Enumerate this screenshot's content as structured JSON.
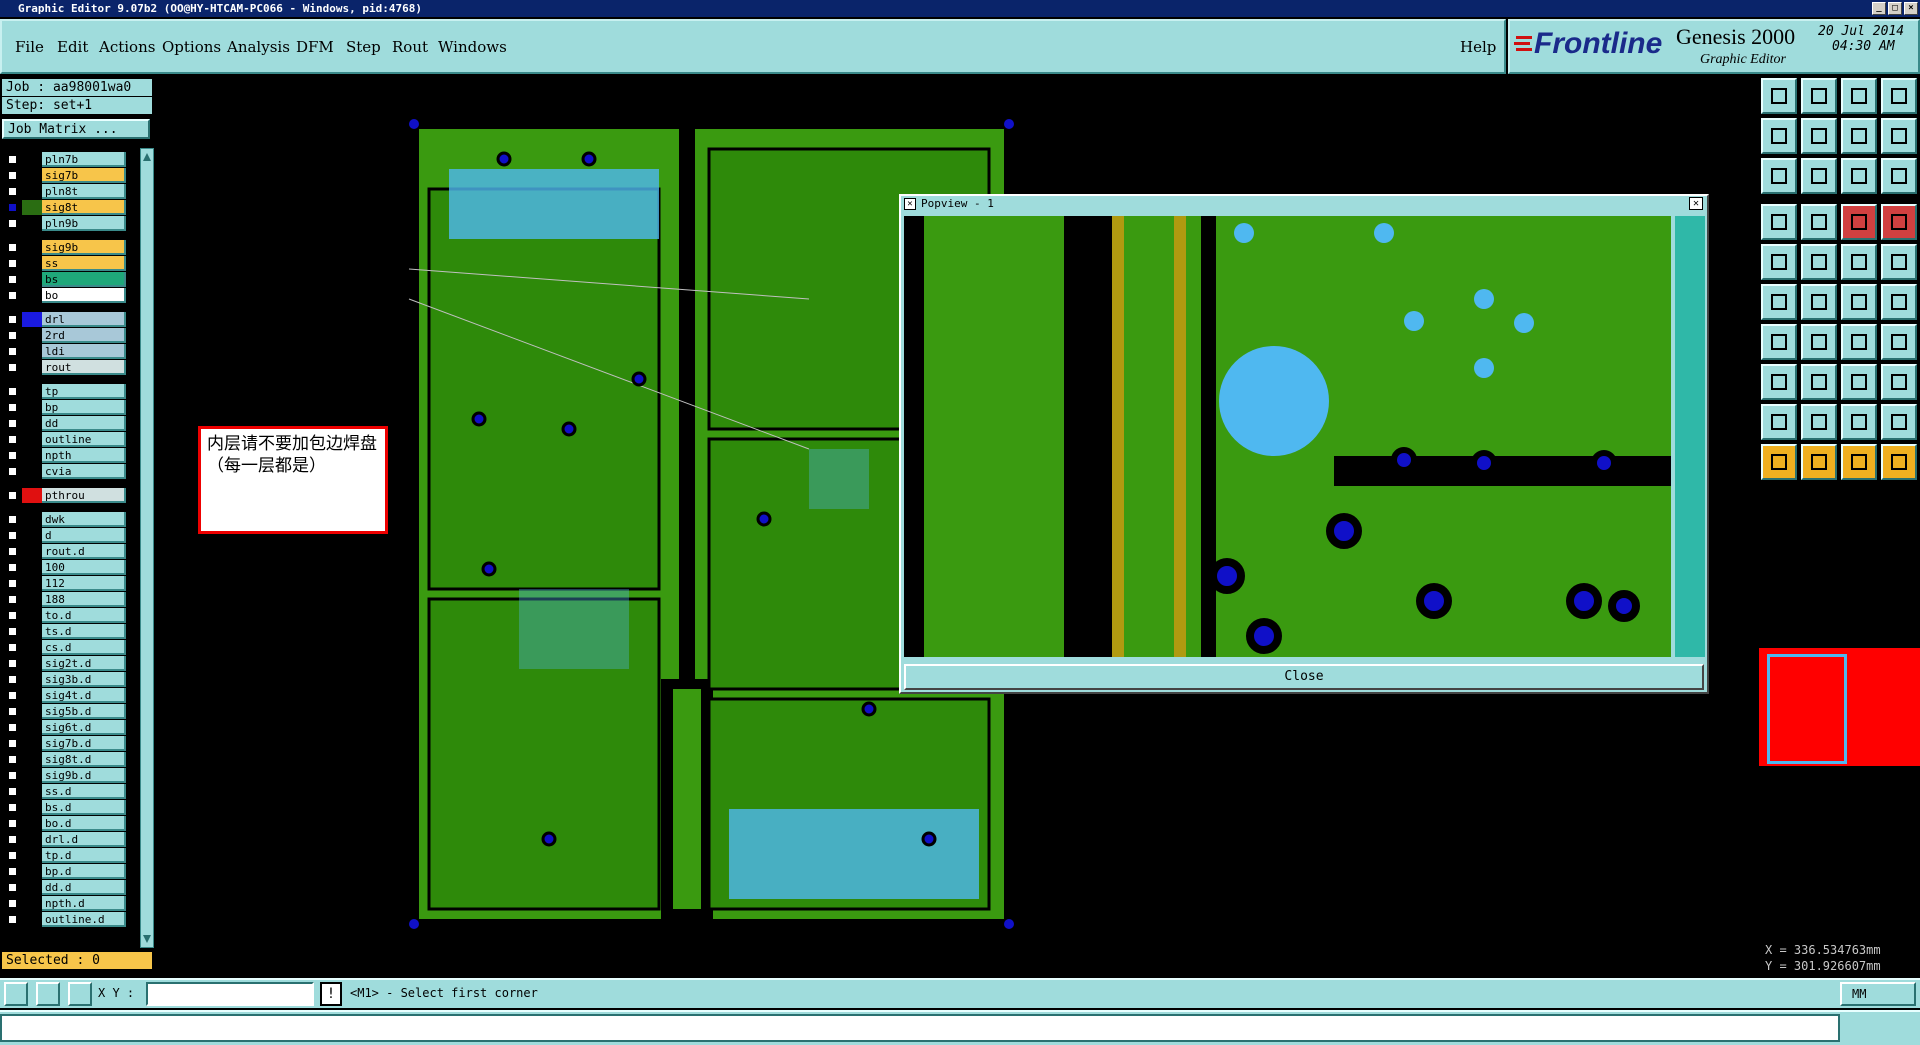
{
  "window": {
    "title": "Graphic Editor 9.07b2 (OO@HY-HTCAM-PC066 - Windows, pid:4768)",
    "controls": [
      "_",
      "□",
      "×"
    ]
  },
  "menu": [
    "File",
    "Edit",
    "Actions",
    "Options",
    "Analysis",
    "DFM",
    "Step",
    "Rout",
    "Windows"
  ],
  "help_label": "Help",
  "brand": {
    "logo": "Frontline",
    "product": "Genesis 2000",
    "subtitle": "Graphic Editor",
    "date": "20 Jul 2014",
    "time": "04:30 AM"
  },
  "job": {
    "label": "Job : aa98001wa0",
    "step": "Step: set+1",
    "matrix_button": "Job Matrix ..."
  },
  "layers": [
    {
      "name": "pln7b",
      "color": "#000000",
      "bg": "#9fdcdc"
    },
    {
      "name": "sig7b",
      "color": "#000000",
      "bg": "#f7c54a"
    },
    {
      "name": "pln8t",
      "color": "#000000",
      "bg": "#9fdcdc"
    },
    {
      "name": "sig8t",
      "color": "#2a6d12",
      "bg": "#f7c54a",
      "active": true
    },
    {
      "name": "pln9b",
      "color": "#000000",
      "bg": "#9fdcdc"
    },
    {
      "name": "sig9b",
      "color": "#000000",
      "bg": "#f7c54a"
    },
    {
      "name": "ss",
      "color": "#000000",
      "bg": "#f7c54a"
    },
    {
      "name": "bs",
      "color": "#000000",
      "bg": "#1fa87a"
    },
    {
      "name": "bo",
      "color": "#000000",
      "bg": "#ffffff"
    },
    {
      "name": "drl",
      "color": "#1a1ae0",
      "bg": "#a8c8d8"
    },
    {
      "name": "2rd",
      "color": "#000000",
      "bg": "#a8c8d8"
    },
    {
      "name": "ldi",
      "color": "#000000",
      "bg": "#a8c8d8"
    },
    {
      "name": "rout",
      "color": "#000000",
      "bg": "#d0e0e0"
    },
    {
      "name": "tp",
      "color": "#000000",
      "bg": "#9fdcdc"
    },
    {
      "name": "bp",
      "color": "#000000",
      "bg": "#9fdcdc"
    },
    {
      "name": "dd",
      "color": "#000000",
      "bg": "#9fdcdc"
    },
    {
      "name": "outline",
      "color": "#000000",
      "bg": "#9fdcdc"
    },
    {
      "name": "npth",
      "color": "#000000",
      "bg": "#9fdcdc"
    },
    {
      "name": "cvia",
      "color": "#000000",
      "bg": "#9fdcdc"
    },
    {
      "name": "pthrou",
      "color": "#e01010",
      "bg": "#d0e0e0"
    },
    {
      "name": "dwk",
      "color": "#000000",
      "bg": "#9fdcdc"
    },
    {
      "name": "d",
      "color": "#000000",
      "bg": "#9fdcdc"
    },
    {
      "name": "rout.d",
      "color": "#000000",
      "bg": "#9fdcdc"
    },
    {
      "name": "100",
      "color": "#000000",
      "bg": "#9fdcdc"
    },
    {
      "name": "112",
      "color": "#000000",
      "bg": "#9fdcdc"
    },
    {
      "name": "188",
      "color": "#000000",
      "bg": "#9fdcdc"
    },
    {
      "name": "to.d",
      "color": "#000000",
      "bg": "#9fdcdc"
    },
    {
      "name": "ts.d",
      "color": "#000000",
      "bg": "#9fdcdc"
    },
    {
      "name": "cs.d",
      "color": "#000000",
      "bg": "#9fdcdc"
    },
    {
      "name": "sig2t.d",
      "color": "#000000",
      "bg": "#9fdcdc"
    },
    {
      "name": "sig3b.d",
      "color": "#000000",
      "bg": "#9fdcdc"
    },
    {
      "name": "sig4t.d",
      "color": "#000000",
      "bg": "#9fdcdc"
    },
    {
      "name": "sig5b.d",
      "color": "#000000",
      "bg": "#9fdcdc"
    },
    {
      "name": "sig6t.d",
      "color": "#000000",
      "bg": "#9fdcdc"
    },
    {
      "name": "sig7b.d",
      "color": "#000000",
      "bg": "#9fdcdc"
    },
    {
      "name": "sig8t.d",
      "color": "#000000",
      "bg": "#9fdcdc"
    },
    {
      "name": "sig9b.d",
      "color": "#000000",
      "bg": "#9fdcdc"
    },
    {
      "name": "ss.d",
      "color": "#000000",
      "bg": "#9fdcdc"
    },
    {
      "name": "bs.d",
      "color": "#000000",
      "bg": "#9fdcdc"
    },
    {
      "name": "bo.d",
      "color": "#000000",
      "bg": "#9fdcdc"
    },
    {
      "name": "drl.d",
      "color": "#000000",
      "bg": "#9fdcdc"
    },
    {
      "name": "tp.d",
      "color": "#000000",
      "bg": "#9fdcdc"
    },
    {
      "name": "bp.d",
      "color": "#000000",
      "bg": "#9fdcdc"
    },
    {
      "name": "dd.d",
      "color": "#000000",
      "bg": "#9fdcdc"
    },
    {
      "name": "npth.d",
      "color": "#000000",
      "bg": "#9fdcdc"
    },
    {
      "name": "outline.d",
      "color": "#000000",
      "bg": "#9fdcdc"
    }
  ],
  "selected": "Selected : 0",
  "note": "内层请不要加包边焊盘（每一层都是）",
  "popview": {
    "title": "Popview - 1",
    "close_label": "Close"
  },
  "coords": {
    "x": "X = 336.534763mm",
    "y": "Y = 301.926607mm"
  },
  "status": {
    "xy_label": "X Y :",
    "xy_value": "",
    "message": "<M1> - Select first corner",
    "units": "MM"
  },
  "colors": {
    "panel": "#9fdcdc",
    "board_green": "#3a9a10",
    "pad_blue": "#1010c8",
    "light_blue": "#4fb8f0"
  }
}
